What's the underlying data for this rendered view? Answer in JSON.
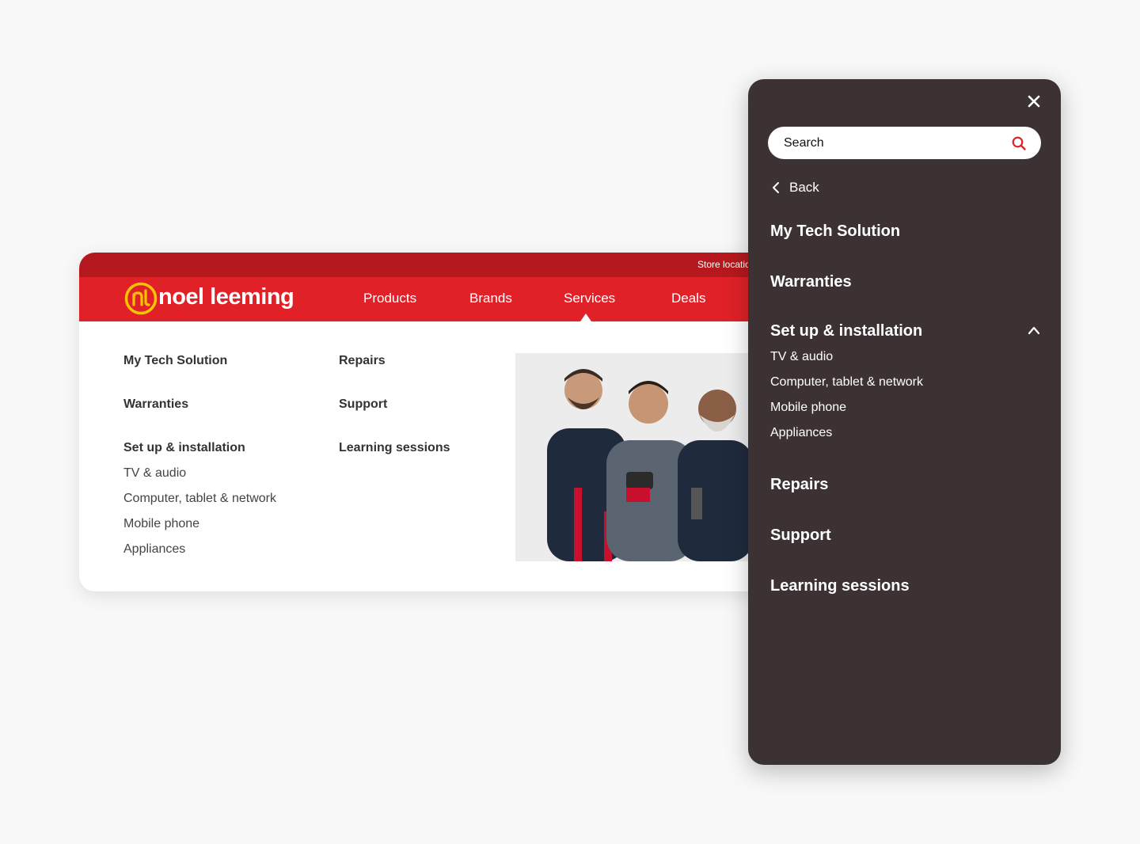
{
  "desktop": {
    "topbar": {
      "store_link": "Store locatio"
    },
    "brand": {
      "name": "noel leeming",
      "logo_color": "#f7c500"
    },
    "nav": [
      "Products",
      "Brands",
      "Services",
      "Deals"
    ],
    "menu": {
      "col1": {
        "my_tech": "My Tech Solution",
        "warranties": "Warranties",
        "setup": "Set up & installation",
        "setup_items": [
          "TV & audio",
          "Computer, tablet & network",
          "Mobile phone",
          "Appliances"
        ]
      },
      "col2": [
        "Repairs",
        "Support",
        "Learning sessions"
      ]
    },
    "colors": {
      "red": "#e02128",
      "dark_red": "#b5191d"
    }
  },
  "mobile": {
    "search": {
      "placeholder": "Search"
    },
    "back_label": "Back",
    "items": [
      "My Tech Solution",
      "Warranties",
      "Set up & installation"
    ],
    "setup_items": [
      "TV & audio",
      "Computer, tablet & network",
      "Mobile phone",
      "Appliances"
    ],
    "more_items": [
      "Repairs",
      "Support",
      "Learning sessions"
    ],
    "colors": {
      "panel_bg": "#3c3234",
      "accent": "#e02128"
    }
  }
}
